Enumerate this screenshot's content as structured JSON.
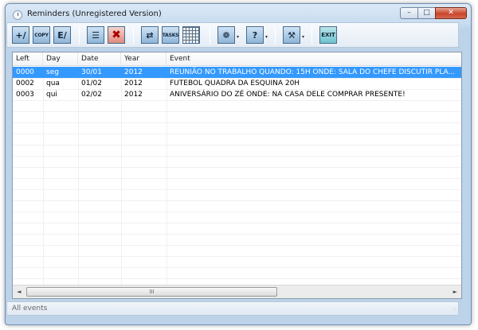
{
  "window": {
    "title": "Reminders (Unregistered Version)",
    "minimize_glyph": "–",
    "maximize_glyph": "□",
    "close_glyph": "✕"
  },
  "toolbar": {
    "buttons": [
      {
        "name": "new-reminder",
        "glyph": "+∕"
      },
      {
        "name": "copy",
        "glyph": "COPY"
      },
      {
        "name": "edit",
        "glyph": "E∕"
      },
      {
        "name": "view-list",
        "glyph": "☰"
      },
      {
        "name": "delete",
        "glyph": "✖"
      },
      {
        "name": "swap",
        "glyph": "⇄"
      },
      {
        "name": "tasks",
        "glyph": "TASKS"
      },
      {
        "name": "calendar-grid",
        "glyph": ""
      },
      {
        "name": "web",
        "glyph": "❁"
      },
      {
        "name": "help",
        "glyph": "?"
      },
      {
        "name": "settings",
        "glyph": "⚒"
      },
      {
        "name": "exit",
        "glyph": "EXIT"
      }
    ],
    "dropdown_glyph": "▾"
  },
  "list": {
    "columns": [
      "Left",
      "Day",
      "Date",
      "Year",
      "Event"
    ],
    "rows": [
      {
        "left": "0000",
        "day": "seg",
        "date": "30/01",
        "year": "2012",
        "event": "REUNIÃO NO TRABALHO    QUANDO: 15H    ONDE: SALA DO CHEFE    DISCUTIR PLA...",
        "selected": true
      },
      {
        "left": "0002",
        "day": "qua",
        "date": "01/02",
        "year": "2012",
        "event": "FUTEBOL    QUADRA DA ESQUINA    20H",
        "selected": false
      },
      {
        "left": "0003",
        "day": "qui",
        "date": "02/02",
        "year": "2012",
        "event": "ANIVERSÁRIO DO ZÉ    ONDE: NA CASA DELE    COMPRAR PRESENTE!",
        "selected": false
      }
    ],
    "scroll_left_glyph": "◄",
    "scroll_right_glyph": "►",
    "thumb_grip": "III"
  },
  "status": {
    "text": "All events",
    "grip": "∴"
  }
}
